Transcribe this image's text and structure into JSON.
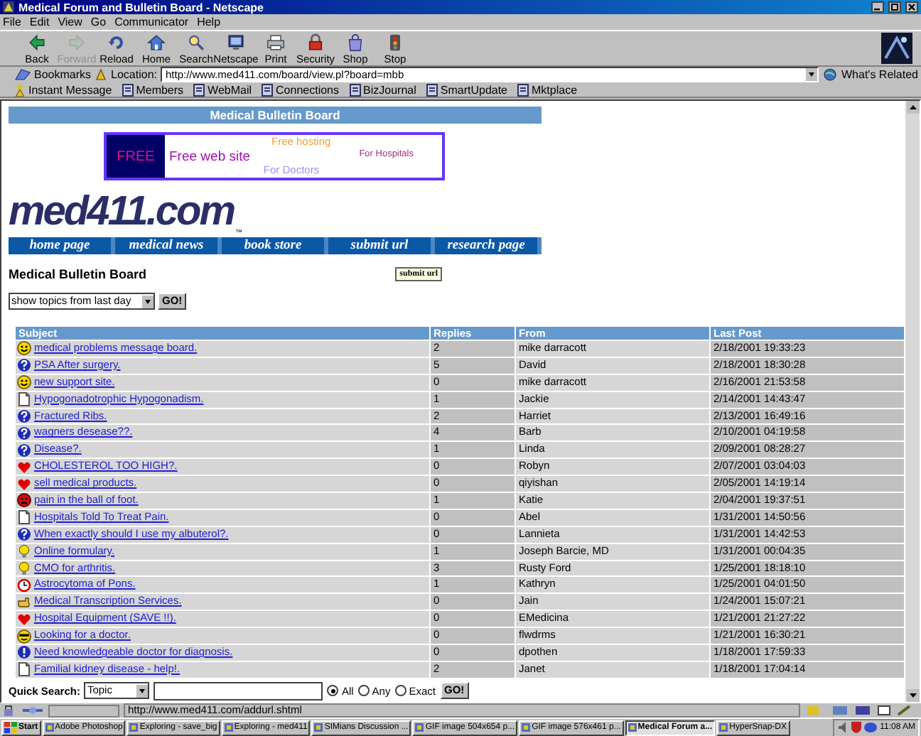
{
  "window": {
    "title": "Medical Forum and Bulletin Board - Netscape"
  },
  "menu": [
    "File",
    "Edit",
    "View",
    "Go",
    "Communicator",
    "Help"
  ],
  "toolbar": [
    {
      "kind": "back",
      "label": "Back",
      "disabled": false
    },
    {
      "kind": "forward",
      "label": "Forward",
      "disabled": true
    },
    {
      "kind": "reload",
      "label": "Reload",
      "disabled": false
    },
    {
      "kind": "home",
      "label": "Home",
      "disabled": false
    },
    {
      "kind": "search",
      "label": "Search",
      "disabled": false
    },
    {
      "kind": "netscape",
      "label": "Netscape",
      "disabled": false
    },
    {
      "kind": "print",
      "label": "Print",
      "disabled": false
    },
    {
      "kind": "security",
      "label": "Security",
      "disabled": false
    },
    {
      "kind": "shop",
      "label": "Shop",
      "disabled": false
    },
    {
      "kind": "stop",
      "label": "Stop",
      "disabled": false
    }
  ],
  "location": {
    "bookmarks": "Bookmarks",
    "label": "Location:",
    "value": "http://www.med411.com/board/view.pl?board=mbb",
    "related": "What's Related"
  },
  "personal_toolbar": [
    "Instant Message",
    "Members",
    "WebMail",
    "Connections",
    "BizJournal",
    "SmartUpdate",
    "Mktplace"
  ],
  "page": {
    "header": "Medical Bulletin Board",
    "banner": {
      "badge": "FREE",
      "headline": "Free web site",
      "hosting": "Free hosting",
      "hospitals": "For Hospitals",
      "doctors": "For Doctors"
    },
    "logo": {
      "text": "med411.com",
      "trademark": "™"
    },
    "nav": [
      "home page",
      "medical news",
      "book store",
      "submit url",
      "research page"
    ],
    "title": "Medical Bulletin Board",
    "submit_button": "submit url",
    "filter": {
      "value": "show topics from last day",
      "button": "GO!"
    },
    "table": {
      "columns": [
        "Subject",
        "Replies",
        "From",
        "Last Post"
      ],
      "rows": [
        {
          "kind": "smile",
          "subject": "medical problems message board.",
          "replies": "2",
          "from": "mike darracott",
          "last_post": "2/18/2001 19:33:23"
        },
        {
          "kind": "question",
          "subject": "PSA After surgery.",
          "replies": "5",
          "from": "David",
          "last_post": "2/18/2001 18:30:28"
        },
        {
          "kind": "smile",
          "subject": "new support site.",
          "replies": "0",
          "from": "mike darracott",
          "last_post": "2/16/2001 21:53:58"
        },
        {
          "kind": "document",
          "subject": "Hypogonadotrophic Hypogonadism.",
          "replies": "1",
          "from": "Jackie",
          "last_post": "2/14/2001 14:43:47"
        },
        {
          "kind": "question",
          "subject": "Fractured Ribs.",
          "replies": "2",
          "from": "Harriet",
          "last_post": "2/13/2001 16:49:16"
        },
        {
          "kind": "question",
          "subject": "wagners desease??.",
          "replies": "4",
          "from": "Barb",
          "last_post": "2/10/2001 04:19:58"
        },
        {
          "kind": "question",
          "subject": "Disease?.",
          "replies": "1",
          "from": "Linda",
          "last_post": "2/09/2001 08:28:27"
        },
        {
          "kind": "heart",
          "subject": "CHOLESTEROL TOO HIGH?.",
          "replies": "0",
          "from": "Robyn",
          "last_post": "2/07/2001 03:04:03"
        },
        {
          "kind": "heart",
          "subject": "sell medical products.",
          "replies": "0",
          "from": "qiyishan",
          "last_post": "2/05/2001 14:19:14"
        },
        {
          "kind": "sad",
          "subject": "pain in the ball of foot.",
          "replies": "1",
          "from": "Katie",
          "last_post": "2/04/2001 19:37:51"
        },
        {
          "kind": "document",
          "subject": "Hospitals Told To Treat Pain.",
          "replies": "0",
          "from": "Abel",
          "last_post": "1/31/2001 14:50:56"
        },
        {
          "kind": "question",
          "subject": "When exactly should I use my albuterol?.",
          "replies": "0",
          "from": "Lannieta",
          "last_post": "1/31/2001 14:42:53"
        },
        {
          "kind": "bulb",
          "subject": "Online formulary.",
          "replies": "1",
          "from": "Joseph Barcie, MD",
          "last_post": "1/31/2001 00:04:35"
        },
        {
          "kind": "bulb",
          "subject": "CMO for arthritis.",
          "replies": "3",
          "from": "Rusty Ford",
          "last_post": "1/25/2001 18:18:10"
        },
        {
          "kind": "clock",
          "subject": "Astrocytoma of Pons.",
          "replies": "1",
          "from": "Kathryn",
          "last_post": "1/25/2001 04:01:50"
        },
        {
          "kind": "hand",
          "subject": "Medical Transcription Services.",
          "replies": "0",
          "from": "Jain",
          "last_post": "1/24/2001 15:07:21"
        },
        {
          "kind": "heart",
          "subject": "Hospital Equipment (SAVE !!).",
          "replies": "0",
          "from": "EMedicina",
          "last_post": "1/21/2001 21:27:22"
        },
        {
          "kind": "cool",
          "subject": "Looking for a doctor.",
          "replies": "0",
          "from": "flwdrms",
          "last_post": "1/21/2001 16:30:21"
        },
        {
          "kind": "exclaim",
          "subject": "Need knowledgeable doctor for diagnosis.",
          "replies": "0",
          "from": "dpothen",
          "last_post": "1/18/2001 17:59:33"
        },
        {
          "kind": "document",
          "subject": "Familial kidney disease - help!.",
          "replies": "2",
          "from": "Janet",
          "last_post": "1/18/2001 17:04:14"
        }
      ]
    },
    "quick_search": {
      "label": "Quick Search:",
      "field": "Topic",
      "options": [
        {
          "label": "All",
          "selected": true
        },
        {
          "label": "Any",
          "selected": false
        },
        {
          "label": "Exact",
          "selected": false
        }
      ],
      "button": "GO!"
    }
  },
  "status_bar": {
    "text": "http://www.med411.com/addurl.shtml"
  },
  "taskbar": {
    "start": "Start",
    "tasks": [
      {
        "label": "Adobe Photoshop",
        "selected": false
      },
      {
        "label": "Exploring - save_big",
        "selected": false
      },
      {
        "label": "Exploring - med411",
        "selected": false
      },
      {
        "label": "SIMians Discussion ...",
        "selected": false
      },
      {
        "label": "GIF image 504x654 p...",
        "selected": false
      },
      {
        "label": "GIF image 576x461 p...",
        "selected": false
      },
      {
        "label": "Medical Forum a...",
        "selected": true
      },
      {
        "label": "HyperSnap-DX",
        "selected": false
      }
    ],
    "clock": "11:08 AM"
  }
}
